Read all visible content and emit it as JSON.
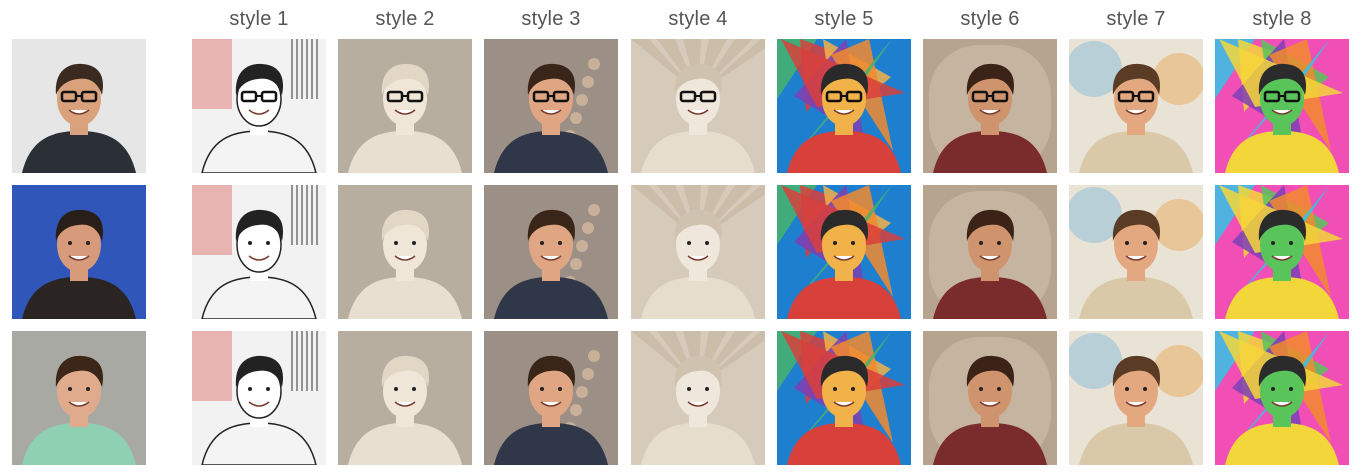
{
  "header": {
    "style_labels": [
      "style 1",
      "style 2",
      "style 3",
      "style 4",
      "style 5",
      "style 6",
      "style 7",
      "style 8"
    ]
  },
  "subjects": [
    {
      "id": "subject-1",
      "bg": "#e6e6e6",
      "skin": "#d9a27d",
      "hair": "#3a2a20",
      "shirt": "#2b2f36",
      "glasses": true
    },
    {
      "id": "subject-2",
      "bg": "#2f56b8",
      "skin": "#d79b7b",
      "hair": "#2a1f18",
      "shirt": "#2a2522",
      "glasses": false
    },
    {
      "id": "subject-3",
      "bg": "#a9a9a4",
      "skin": "#e0ab8d",
      "hair": "#3b2618",
      "shirt": "#8fd0b2",
      "glasses": false
    }
  ],
  "styles": [
    {
      "name": "line-sketch",
      "bg": "#f2f2f2",
      "skin": "#ffffff",
      "hair": "#222222",
      "shirt": "#f4f4f4",
      "accent": "#d3423a"
    },
    {
      "name": "marble-bust",
      "bg": "#b8aea0",
      "skin": "#efe6d8",
      "hair": "#e2d6c5",
      "shirt": "#e8dfd0",
      "accent": "#8a5a2b"
    },
    {
      "name": "photoreal",
      "bg": "#9b8f86",
      "skin": "#e0a684",
      "hair": "#3a2619",
      "shirt": "#2f3748",
      "accent": "#e8c7a6"
    },
    {
      "name": "paper-fold",
      "bg": "#d6cbbb",
      "skin": "#efe7db",
      "hair": "#cfc2ae",
      "shirt": "#e7ddcd",
      "accent": "#b6a48c"
    },
    {
      "name": "cubist",
      "bg": "#1f7fcf",
      "skin": "#f2b24a",
      "hair": "#2a2a2a",
      "shirt": "#d8403b",
      "accent": "#49b36d"
    },
    {
      "name": "renaissance",
      "bg": "#b7a48f",
      "skin": "#cf946d",
      "hair": "#3b2417",
      "shirt": "#7a2b2b",
      "accent": "#e4d9c6"
    },
    {
      "name": "watercolor",
      "bg": "#e9e3d6",
      "skin": "#e4a880",
      "hair": "#5a3b25",
      "shirt": "#d9c9a8",
      "accent": "#d44a5a"
    },
    {
      "name": "pop-art",
      "bg": "#f24fb6",
      "skin": "#59c45a",
      "hair": "#2b2b2b",
      "shirt": "#f3d63a",
      "accent": "#33c3e6"
    }
  ]
}
